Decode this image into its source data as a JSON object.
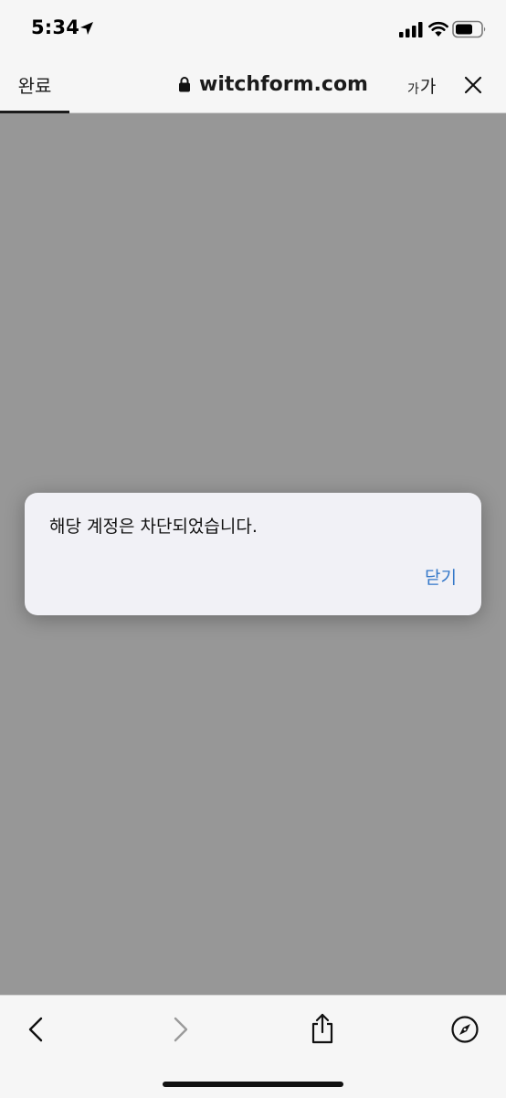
{
  "status_bar": {
    "time": "5:34",
    "icons": [
      "location-arrow-icon",
      "signal-icon",
      "wifi-icon",
      "battery-icon"
    ]
  },
  "toolbar": {
    "done_label": "완료",
    "domain": "witchform.com",
    "text_size_small": "가",
    "text_size_large": "가",
    "icons": [
      "lock-icon",
      "close-icon"
    ]
  },
  "alert": {
    "message": "해당 계정은 차단되었습니다.",
    "close_label": "닫기"
  },
  "bottom_bar": {
    "icons": [
      "back-icon",
      "forward-icon",
      "share-icon",
      "compass-icon"
    ]
  },
  "colors": {
    "overlay": "#979797",
    "bar": "#f6f6f6",
    "alert_bg": "#f1f1f6",
    "link": "#3478c9",
    "forward_disabled": "#9b9b9b"
  }
}
